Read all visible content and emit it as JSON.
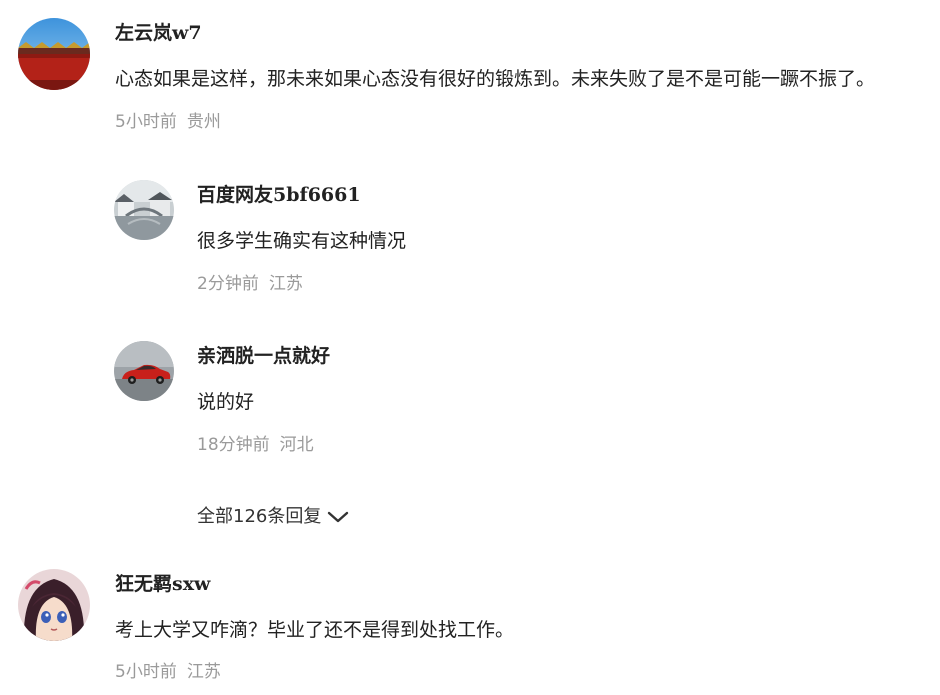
{
  "comments": [
    {
      "author_cn": "左云岚",
      "author_suffix": "w7",
      "text": "心态如果是这样，那未来如果心态没有很好的锻炼到。未来失败了是不是可能一蹶不振了。",
      "time": "5小时前",
      "location": "贵州",
      "avatar_icon": "forbidden-city-wall-avatar",
      "replies": [
        {
          "author_cn": "百度网友",
          "author_suffix": "5bf6661",
          "text": "很多学生确实有这种情况",
          "time": "2分钟前",
          "location": "江苏",
          "avatar_icon": "water-town-avatar"
        },
        {
          "author_cn": "亲洒脱一点就好",
          "author_suffix": "",
          "text": "说的好",
          "time": "18分钟前",
          "location": "河北",
          "avatar_icon": "red-sports-car-avatar"
        }
      ],
      "more_replies_label": "全部126条回复",
      "more_replies_icon": "chevron-down-icon"
    },
    {
      "author_cn": "狂无羁",
      "author_suffix": "sxw",
      "text": "考上大学又咋滴？毕业了还不是得到处找工作。",
      "time": "5小时前",
      "location": "江苏",
      "avatar_icon": "anime-girl-avatar"
    }
  ],
  "colors": {
    "text_primary": "#222222",
    "text_meta": "#9a9a9a",
    "background": "#ffffff"
  }
}
